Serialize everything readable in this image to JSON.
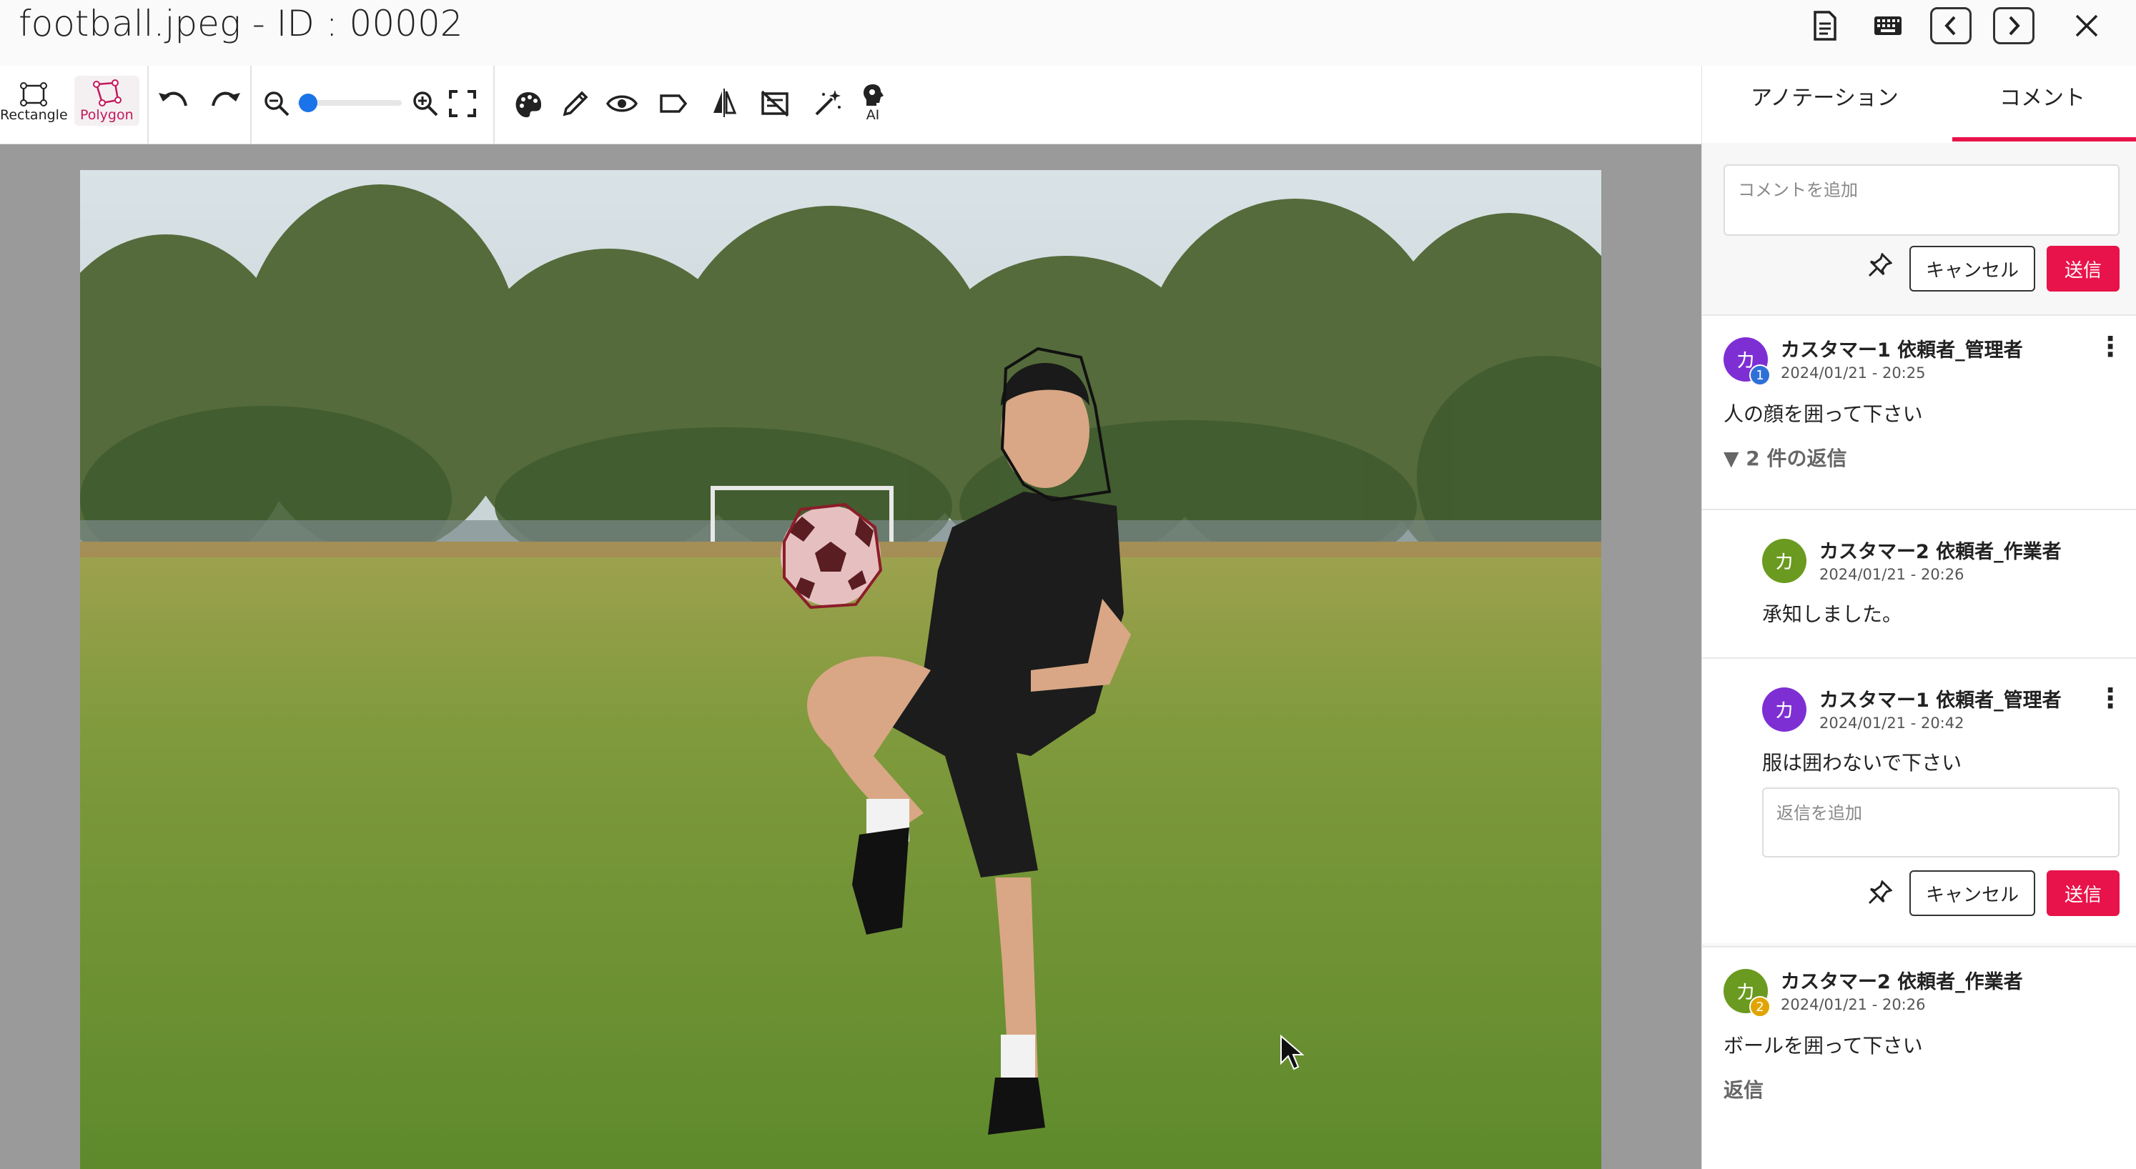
{
  "window": {
    "title": "football.jpeg - ID : 00002",
    "icons": [
      "document-icon",
      "keyboard-icon",
      "previous-icon",
      "next-icon",
      "close-icon"
    ]
  },
  "toolbar": {
    "rectangle_label": "Rectangle",
    "polygon_label": "Polygon",
    "ai_label": "AI",
    "zoom_level": 0.02,
    "icons": [
      "undo-icon",
      "redo-icon",
      "zoom-out-icon",
      "zoom-in-icon",
      "fit-screen-icon",
      "palette-icon",
      "pencil-icon",
      "eye-icon",
      "label-icon",
      "flip-icon",
      "hide-labels-icon",
      "magic-wand-icon",
      "ai-icon"
    ]
  },
  "sidebar": {
    "tabs": [
      {
        "label": "アノテーション",
        "active": false
      },
      {
        "label": "コメント",
        "active": true
      }
    ],
    "comment_placeholder": "コメントを追加",
    "cancel_label": "キャンセル",
    "send_label": "送信",
    "threads": [
      {
        "avatar": "カ",
        "avatar_color": "#7e2fd4",
        "badge": "1",
        "badge_color": "#2f6fd8",
        "name": "カスタマー1 依頼者_管理者",
        "date": "2024/01/21 - 20:25",
        "text": "人の顔を囲って下さい",
        "replies_toggle": "▼ 2 件の返信",
        "replies": [
          {
            "avatar": "カ",
            "avatar_color": "#6a9a1f",
            "name": "カスタマー2 依頼者_作業者",
            "date": "2024/01/21 - 20:26",
            "text": "承知しました。"
          },
          {
            "avatar": "カ",
            "avatar_color": "#7e2fd4",
            "name": "カスタマー1 依頼者_管理者",
            "date": "2024/01/21 - 20:42",
            "text": "服は囲わないで下さい"
          }
        ],
        "reply_placeholder": "返信を追加"
      },
      {
        "avatar": "カ",
        "avatar_color": "#6a9a1f",
        "badge": "2",
        "badge_color": "#e0a400",
        "name": "カスタマー2 依頼者_作業者",
        "date": "2024/01/21 - 20:26",
        "text": "ボールを囲って下さい",
        "reply_link": "返信"
      }
    ]
  },
  "colors": {
    "accent": "#e8134a",
    "active_tool": "#c2185b",
    "zoom_thumb": "#1a73e8"
  }
}
